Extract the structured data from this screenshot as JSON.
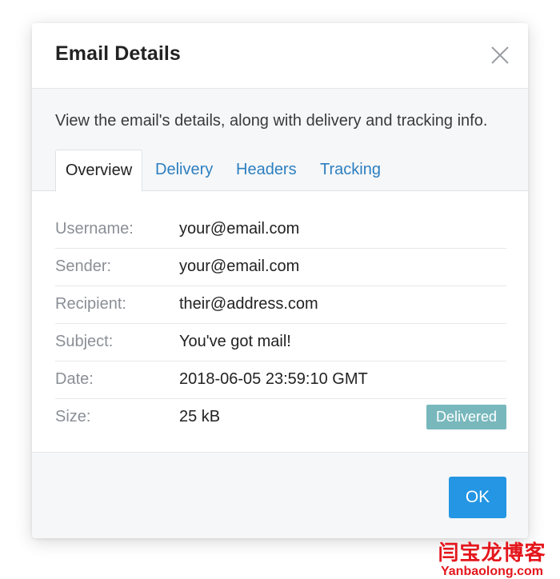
{
  "modal": {
    "title": "Email Details",
    "close_icon": "close-icon",
    "description": "View the email's details, along with delivery and tracking info."
  },
  "tabs": [
    {
      "label": "Overview",
      "active": true
    },
    {
      "label": "Delivery",
      "active": false
    },
    {
      "label": "Headers",
      "active": false
    },
    {
      "label": "Tracking",
      "active": false
    }
  ],
  "details": [
    {
      "label": "Username:",
      "value": "your@email.com"
    },
    {
      "label": "Sender:",
      "value": "your@email.com"
    },
    {
      "label": "Recipient:",
      "value": "their@address.com"
    },
    {
      "label": "Subject:",
      "value": "You've got mail!"
    },
    {
      "label": "Date:",
      "value": "2018-06-05 23:59:10 GMT"
    },
    {
      "label": "Size:",
      "value": "25 kB"
    }
  ],
  "status_badge": "Delivered",
  "footer": {
    "ok_label": "OK"
  },
  "watermark": {
    "chinese": "闫宝龙博客",
    "latin": "Yanbaolong.com"
  },
  "colors": {
    "accent": "#2496e3",
    "tab_link": "#2d7fbf",
    "badge": "#78b8bd",
    "watermark": "#e4161c"
  }
}
